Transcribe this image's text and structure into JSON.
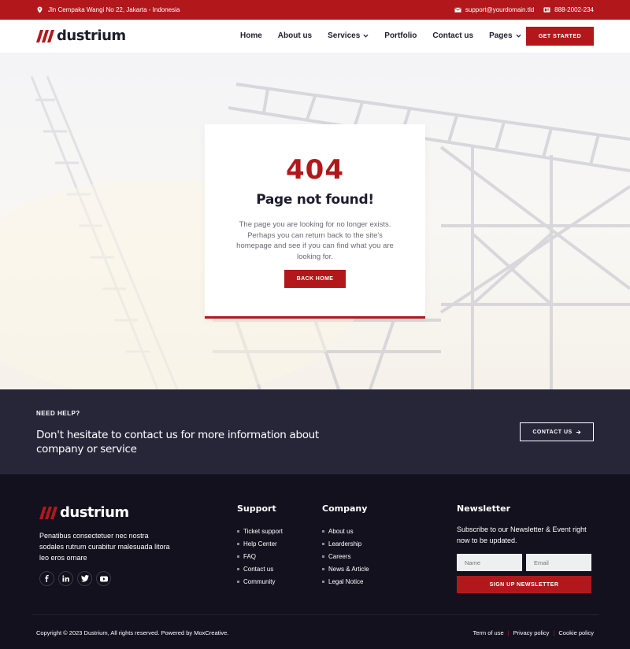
{
  "topbar": {
    "address": "Jln Cempaka Wangi No 22, Jakarta - Indonesia",
    "email": "support@yourdomain.tld",
    "phone": "888-2002-234"
  },
  "brand": {
    "name": "dustrium",
    "accent": "#b2181b",
    "dark": "#272639",
    "footer_bg": "#12111d"
  },
  "nav": {
    "items": [
      {
        "label": "Home",
        "dropdown": false
      },
      {
        "label": "About us",
        "dropdown": false
      },
      {
        "label": "Services",
        "dropdown": true
      },
      {
        "label": "Portfolio",
        "dropdown": false
      },
      {
        "label": "Contact us",
        "dropdown": false
      },
      {
        "label": "Pages",
        "dropdown": true
      }
    ],
    "cta": "GET STARTED"
  },
  "error": {
    "code": "404",
    "title": "Page not found!",
    "description": "The page you are looking for no longer exists. Perhaps you can return back to the site's homepage and see if you can find what you are looking for.",
    "button": "BACK HOME"
  },
  "help": {
    "kicker": "NEED HELP?",
    "message": "Don't hesitate to contact us for more information about company or service",
    "button": "CONTACT US"
  },
  "footer": {
    "about": "Penatibus consectetuer nec nostra sodales rutrum curabitur malesuada litora leo eros ornare",
    "social": [
      "facebook-icon",
      "linkedin-icon",
      "twitter-icon",
      "youtube-icon"
    ],
    "support": {
      "title": "Support",
      "links": [
        "Ticket support",
        "Help Center",
        "FAQ",
        "Contact us",
        "Community"
      ]
    },
    "company": {
      "title": "Company",
      "links": [
        "About us",
        "Leardership",
        "Careers",
        "News & Article",
        "Legal Notice"
      ]
    },
    "newsletter": {
      "title": "Newsletter",
      "text": "Subscribe to our Newsletter & Event right now to be updated.",
      "name_placeholder": "Name",
      "email_placeholder": "Email",
      "button": "SIGN UP NEWSLETTER"
    },
    "copyright": "Copyright © 2023 Dustrium, All rights reserved. Powered by MoxCreative.",
    "legal": [
      "Term of use",
      "Privacy policy",
      "Cookie policy"
    ]
  }
}
